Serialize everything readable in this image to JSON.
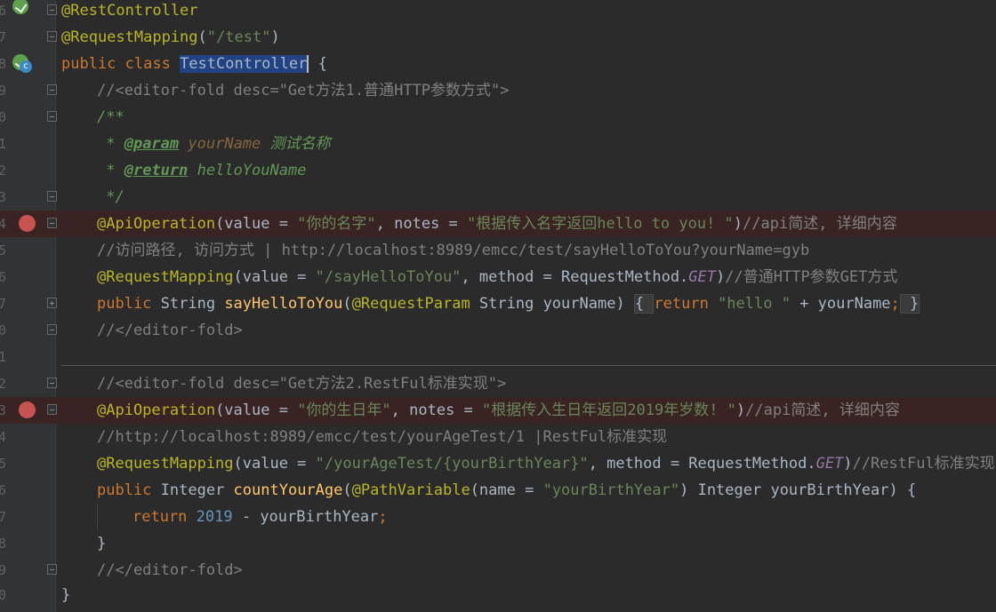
{
  "gutter": {
    "line_numbers": [
      "6",
      "7",
      "8",
      "9",
      "0",
      "1",
      "2",
      "3",
      "4",
      "5",
      "6",
      "7",
      "0",
      "1",
      "2",
      "3",
      "4",
      "5",
      "6",
      "7",
      "8",
      "9",
      "0"
    ]
  },
  "code": {
    "l1": {
      "ann": "@RestController"
    },
    "l2": {
      "ann": "@RequestMapping",
      "p1": "(",
      "str": "\"/test\"",
      "p2": ")"
    },
    "l3": {
      "kw": "public class ",
      "name": "TestController",
      "rest": " {"
    },
    "l4": {
      "com": "//<editor-fold desc=\"Get方法1.普通HTTP参数方式\">"
    },
    "l5": {
      "doc": "/**"
    },
    "l6": {
      "star": " * ",
      "tag": "@param",
      "sp": " ",
      "param": "yourName",
      "desc": " 测试名称"
    },
    "l7": {
      "star": " * ",
      "tag": "@return",
      "desc": " helloYouName"
    },
    "l8": {
      "doc": " */"
    },
    "l9": {
      "ann": "@ApiOperation",
      "p1": "(value = ",
      "s1": "\"你的名字\"",
      "p2": ", notes = ",
      "s2": "\"根据传入名字返回hello to you! \"",
      "p3": ")",
      "com": "//api简述, 详细内容"
    },
    "l10": {
      "com": "//访问路径, 访问方式 | http://localhost:8989/emcc/test/sayHelloToYou?yourName=gyb"
    },
    "l11": {
      "ann": "@RequestMapping",
      "p1": "(value = ",
      "s1": "\"/sayHelloToYou\"",
      "p2": ", method = RequestMethod.",
      "st": "GET",
      "p3": ")",
      "com": "//普通HTTP参数GET方式"
    },
    "l12": {
      "kw": "public ",
      "t1": "String ",
      "meth": "sayHelloToYou",
      "p1": "(",
      "ann": "@RequestParam",
      "p2": " String yourName) ",
      "fb1": "{ ",
      "kw2": "return ",
      "s1": "\"hello \"",
      "p3": " + yourName",
      "semi": ";",
      "fb2": " }"
    },
    "l13": {
      "com": "//</editor-fold>"
    },
    "l15": {
      "com": "//<editor-fold desc=\"Get方法2.RestFul标准实现\">"
    },
    "l16": {
      "ann": "@ApiOperation",
      "p1": "(value = ",
      "s1": "\"你的生日年\"",
      "p2": ", notes = ",
      "s2": "\"根据传入生日年返回2019年岁数! \"",
      "p3": ")",
      "com": "//api简述, 详细内容"
    },
    "l17": {
      "com": "//http://localhost:8989/emcc/test/yourAgeTest/1 |RestFul标准实现"
    },
    "l18": {
      "ann": "@RequestMapping",
      "p1": "(value = ",
      "s1": "\"/yourAgeTest/{yourBirthYear}\"",
      "p2": ", method = RequestMethod.",
      "st": "GET",
      "p3": ")",
      "com": "//RestFul标准实现,"
    },
    "l19": {
      "kw": "public ",
      "t1": "Integer ",
      "meth": "countYourAge",
      "p1": "(",
      "ann": "@PathVariable",
      "p2": "(name = ",
      "s1": "\"yourBirthYear\"",
      "p3": ") Integer yourBirthYear) {"
    },
    "l20": {
      "kw": "return ",
      "num": "2019",
      "p1": " - yourBirthYear",
      "semi": ";"
    },
    "l21": {
      "brace": "}"
    },
    "l22": {
      "com": "//</editor-fold>"
    },
    "l23": {
      "brace": "}"
    }
  }
}
